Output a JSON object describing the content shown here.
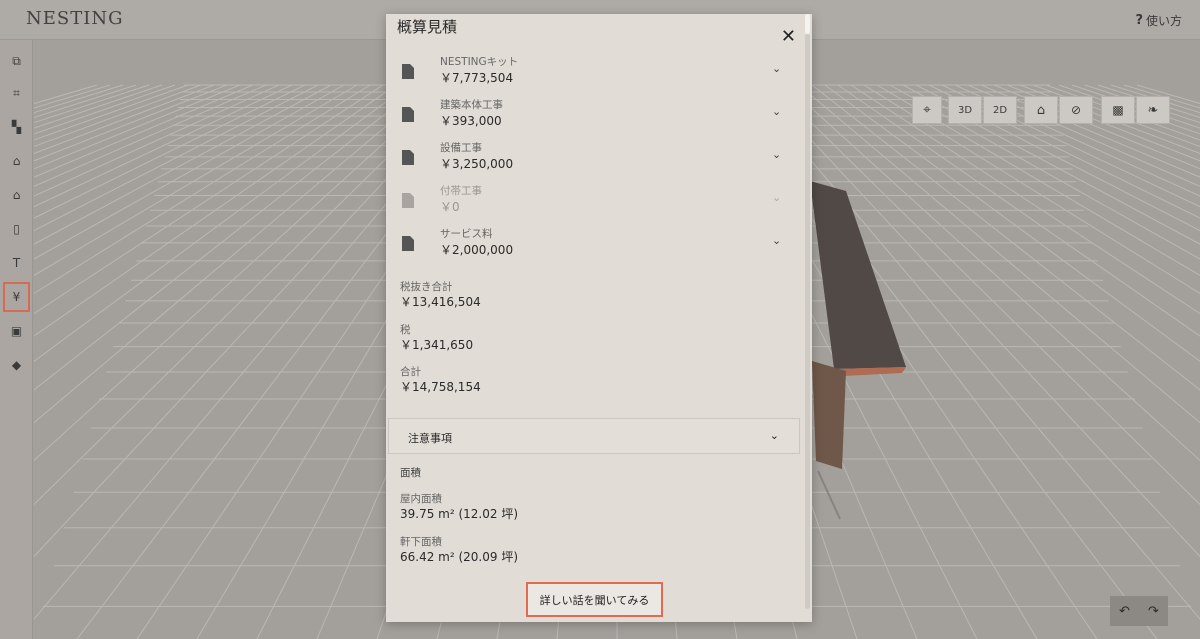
{
  "app": {
    "logo": "NESTING",
    "help_label": "使い方",
    "help_icon": "?"
  },
  "sidebar": {
    "items": [
      {
        "name": "floorplan-icon",
        "glyph": "⧉"
      },
      {
        "name": "grid-icon",
        "glyph": "⌗"
      },
      {
        "name": "widgets-icon",
        "glyph": "▚"
      },
      {
        "name": "home-icon",
        "glyph": "⌂"
      },
      {
        "name": "home-outline-icon",
        "glyph": "⌂"
      },
      {
        "name": "door-icon",
        "glyph": "▯"
      },
      {
        "name": "text-icon",
        "glyph": "T"
      },
      {
        "name": "yen-icon",
        "glyph": "¥",
        "active": true
      },
      {
        "name": "save-icon",
        "glyph": "▣"
      },
      {
        "name": "export-icon",
        "glyph": "◆"
      }
    ]
  },
  "toolbar": {
    "locate_icon": "⌖",
    "view_3d": "3D",
    "view_2d": "2D",
    "roof_icon": "⌂",
    "roof_off_icon": "⊘",
    "texture_off_icon": "▩",
    "leaf_icon": "❧",
    "undo": "↶",
    "redo": "↷"
  },
  "modal": {
    "title": "概算見積",
    "close": "✕",
    "items": [
      {
        "name": "NESTINGキット",
        "price": "￥7,773,504",
        "disabled": false
      },
      {
        "name": "建築本体工事",
        "price": "￥393,000",
        "disabled": false
      },
      {
        "name": "設備工事",
        "price": "￥3,250,000",
        "disabled": false
      },
      {
        "name": "付帯工事",
        "price": "￥0",
        "disabled": true
      },
      {
        "name": "サービス料",
        "price": "￥2,000,000",
        "disabled": false
      }
    ],
    "chevron": "⌄",
    "subtotal_label": "税抜き合計",
    "subtotal_value": "￥13,416,504",
    "tax_label": "税",
    "tax_value": "￥1,341,650",
    "total_label": "合計",
    "total_value": "￥14,758,154",
    "notice_label": "注意事項",
    "area_heading": "面積",
    "indoor_label": "屋内面積",
    "indoor_value": "39.75 m² (12.02 坪)",
    "eaves_label": "軒下面積",
    "eaves_value": "66.42 m² (20.09 坪)",
    "detail_button": "詳しい話を聞いてみる"
  },
  "colors": {
    "accent": "#e26a4f",
    "modal_bg": "#e1dcd6",
    "scene_bg": "#a9a6a1"
  }
}
